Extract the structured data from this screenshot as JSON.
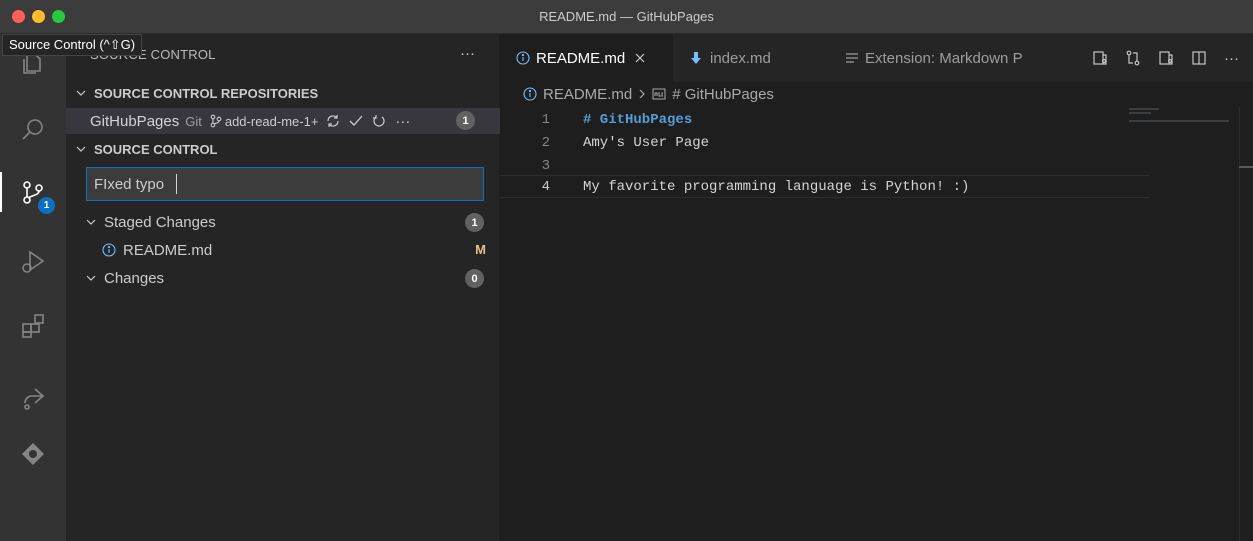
{
  "window": {
    "title": "README.md — GitHubPages"
  },
  "tooltip": {
    "text": "Source Control (^⇧G)"
  },
  "activity_bar": {
    "items": [
      "explorer-icon",
      "search-icon",
      "source-control-icon",
      "run-debug-icon",
      "extensions-icon",
      "live-share-icon",
      "gitlens-icon"
    ],
    "source_control_badge": "1"
  },
  "sidebar": {
    "header": "SOURCE CONTROL",
    "more_label": "···",
    "repositories_section": "SOURCE CONTROL REPOSITORIES",
    "repo": {
      "name": "GitHubPages",
      "provider": "Git",
      "branch": "add-read-me-1+",
      "more_label": "···",
      "count": "1"
    },
    "source_control_section": "SOURCE CONTROL",
    "commit_message": "FIxed typo",
    "staged": {
      "label": "Staged Changes",
      "count": "1",
      "files": [
        {
          "name": "README.md",
          "status": "M"
        }
      ]
    },
    "changes": {
      "label": "Changes",
      "count": "0"
    }
  },
  "tabs": [
    {
      "label": "README.md",
      "active": true,
      "icon": "info-icon"
    },
    {
      "label": "index.md",
      "active": false,
      "icon": "markdown-icon"
    },
    {
      "label": "Extension: Markdown P",
      "active": false,
      "icon": "list-icon"
    }
  ],
  "tab_actions": {
    "more_label": "···"
  },
  "breadcrumb": {
    "file": "README.md",
    "symbol": "# GitHubPages"
  },
  "editor": {
    "lines": [
      {
        "number": "1",
        "text": "# GitHubPages"
      },
      {
        "number": "2",
        "text": "Amy's User Page"
      },
      {
        "number": "3",
        "text": ""
      },
      {
        "number": "4",
        "text": "My favorite programming language is Python! :)"
      }
    ]
  },
  "colors": {
    "accent": "#0e70c0",
    "heading": "#569cd6",
    "modified": "#e2c08d"
  }
}
